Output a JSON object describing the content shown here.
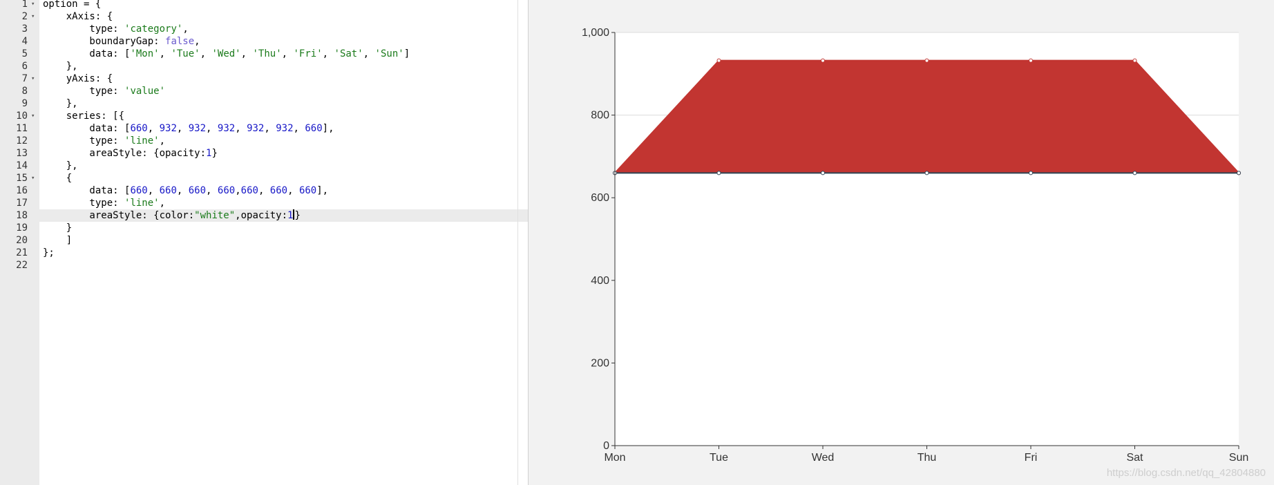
{
  "editor": {
    "active_line": 18,
    "lines": [
      {
        "n": "1",
        "fold": true,
        "tokens": [
          {
            "t": "option = {",
            "c": ""
          }
        ]
      },
      {
        "n": "2",
        "fold": true,
        "tokens": [
          {
            "t": "    xAxis: {",
            "c": ""
          }
        ]
      },
      {
        "n": "3",
        "fold": false,
        "tokens": [
          {
            "t": "        type: ",
            "c": ""
          },
          {
            "t": "'category'",
            "c": "str"
          },
          {
            "t": ",",
            "c": ""
          }
        ]
      },
      {
        "n": "4",
        "fold": false,
        "tokens": [
          {
            "t": "        boundaryGap: ",
            "c": ""
          },
          {
            "t": "false",
            "c": "kw"
          },
          {
            "t": ",",
            "c": ""
          }
        ]
      },
      {
        "n": "5",
        "fold": false,
        "tokens": [
          {
            "t": "        data: [",
            "c": ""
          },
          {
            "t": "'Mon'",
            "c": "str"
          },
          {
            "t": ", ",
            "c": ""
          },
          {
            "t": "'Tue'",
            "c": "str"
          },
          {
            "t": ", ",
            "c": ""
          },
          {
            "t": "'Wed'",
            "c": "str"
          },
          {
            "t": ", ",
            "c": ""
          },
          {
            "t": "'Thu'",
            "c": "str"
          },
          {
            "t": ", ",
            "c": ""
          },
          {
            "t": "'Fri'",
            "c": "str"
          },
          {
            "t": ", ",
            "c": ""
          },
          {
            "t": "'Sat'",
            "c": "str"
          },
          {
            "t": ", ",
            "c": ""
          },
          {
            "t": "'Sun'",
            "c": "str"
          },
          {
            "t": "]",
            "c": ""
          }
        ]
      },
      {
        "n": "6",
        "fold": false,
        "tokens": [
          {
            "t": "    },",
            "c": ""
          }
        ]
      },
      {
        "n": "7",
        "fold": true,
        "tokens": [
          {
            "t": "    yAxis: {",
            "c": ""
          }
        ]
      },
      {
        "n": "8",
        "fold": false,
        "tokens": [
          {
            "t": "        type: ",
            "c": ""
          },
          {
            "t": "'value'",
            "c": "str"
          }
        ]
      },
      {
        "n": "9",
        "fold": false,
        "tokens": [
          {
            "t": "    },",
            "c": ""
          }
        ]
      },
      {
        "n": "10",
        "fold": true,
        "tokens": [
          {
            "t": "    series: [{",
            "c": ""
          }
        ]
      },
      {
        "n": "11",
        "fold": false,
        "tokens": [
          {
            "t": "        data: [",
            "c": ""
          },
          {
            "t": "660",
            "c": "num"
          },
          {
            "t": ", ",
            "c": ""
          },
          {
            "t": "932",
            "c": "num"
          },
          {
            "t": ", ",
            "c": ""
          },
          {
            "t": "932",
            "c": "num"
          },
          {
            "t": ", ",
            "c": ""
          },
          {
            "t": "932",
            "c": "num"
          },
          {
            "t": ", ",
            "c": ""
          },
          {
            "t": "932",
            "c": "num"
          },
          {
            "t": ", ",
            "c": ""
          },
          {
            "t": "932",
            "c": "num"
          },
          {
            "t": ", ",
            "c": ""
          },
          {
            "t": "660",
            "c": "num"
          },
          {
            "t": "],",
            "c": ""
          }
        ]
      },
      {
        "n": "12",
        "fold": false,
        "tokens": [
          {
            "t": "        type: ",
            "c": ""
          },
          {
            "t": "'line'",
            "c": "str"
          },
          {
            "t": ",",
            "c": ""
          }
        ]
      },
      {
        "n": "13",
        "fold": false,
        "tokens": [
          {
            "t": "        areaStyle: {opacity:",
            "c": ""
          },
          {
            "t": "1",
            "c": "num"
          },
          {
            "t": "}",
            "c": ""
          }
        ]
      },
      {
        "n": "14",
        "fold": false,
        "tokens": [
          {
            "t": "    },",
            "c": ""
          }
        ]
      },
      {
        "n": "15",
        "fold": true,
        "tokens": [
          {
            "t": "    {",
            "c": ""
          }
        ]
      },
      {
        "n": "16",
        "fold": false,
        "tokens": [
          {
            "t": "        data: [",
            "c": ""
          },
          {
            "t": "660",
            "c": "num"
          },
          {
            "t": ", ",
            "c": ""
          },
          {
            "t": "660",
            "c": "num"
          },
          {
            "t": ", ",
            "c": ""
          },
          {
            "t": "660",
            "c": "num"
          },
          {
            "t": ", ",
            "c": ""
          },
          {
            "t": "660",
            "c": "num"
          },
          {
            "t": ",",
            "c": ""
          },
          {
            "t": "660",
            "c": "num"
          },
          {
            "t": ", ",
            "c": ""
          },
          {
            "t": "660",
            "c": "num"
          },
          {
            "t": ", ",
            "c": ""
          },
          {
            "t": "660",
            "c": "num"
          },
          {
            "t": "],",
            "c": ""
          }
        ]
      },
      {
        "n": "17",
        "fold": false,
        "tokens": [
          {
            "t": "        type: ",
            "c": ""
          },
          {
            "t": "'line'",
            "c": "str"
          },
          {
            "t": ",",
            "c": ""
          }
        ]
      },
      {
        "n": "18",
        "fold": false,
        "tokens": [
          {
            "t": "        areaStyle: {color:",
            "c": ""
          },
          {
            "t": "\"white\"",
            "c": "str"
          },
          {
            "t": ",opacity:",
            "c": ""
          },
          {
            "t": "1",
            "c": "num"
          },
          {
            "t": "|",
            "c": "cursor"
          },
          {
            "t": "}",
            "c": ""
          }
        ]
      },
      {
        "n": "19",
        "fold": false,
        "tokens": [
          {
            "t": "    }",
            "c": ""
          }
        ]
      },
      {
        "n": "20",
        "fold": false,
        "tokens": [
          {
            "t": "    ]",
            "c": ""
          }
        ]
      },
      {
        "n": "21",
        "fold": false,
        "tokens": [
          {
            "t": "};",
            "c": ""
          }
        ]
      },
      {
        "n": "22",
        "fold": false,
        "tokens": []
      }
    ]
  },
  "chart_data": {
    "type": "area",
    "categories": [
      "Mon",
      "Tue",
      "Wed",
      "Thu",
      "Fri",
      "Sat",
      "Sun"
    ],
    "ylim": [
      0,
      1000
    ],
    "yticks": [
      0,
      200,
      400,
      600,
      800,
      1000
    ],
    "ytick_labels": [
      "0",
      "200",
      "400",
      "600",
      "800",
      "1,000"
    ],
    "grid": true,
    "series": [
      {
        "values": [
          660,
          932,
          932,
          932,
          932,
          932,
          660
        ],
        "color": "#c23531",
        "area_opacity": 1
      },
      {
        "values": [
          660,
          660,
          660,
          660,
          660,
          660,
          660
        ],
        "color": "#2f4554",
        "area_color": "#ffffff",
        "area_opacity": 1
      }
    ]
  },
  "watermark": "https://blog.csdn.net/qq_42804880"
}
